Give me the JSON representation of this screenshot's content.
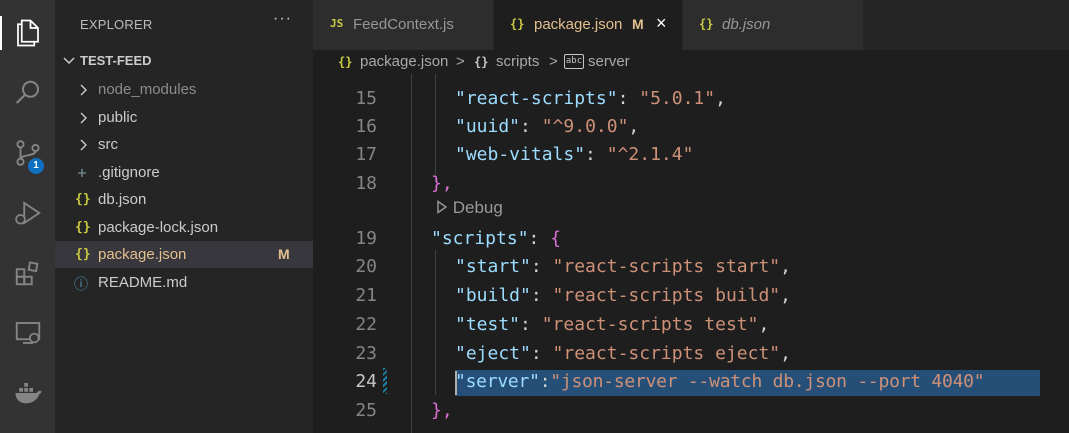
{
  "activity": {
    "items": [
      {
        "icon": "files-icon"
      },
      {
        "icon": "search-icon"
      },
      {
        "icon": "source-control-icon",
        "badge": "1"
      },
      {
        "icon": "run-debug-icon"
      },
      {
        "icon": "extensions-icon"
      },
      {
        "icon": "remote-explorer-icon"
      },
      {
        "icon": "docker-icon"
      }
    ]
  },
  "sidebar": {
    "title": "EXPLORER",
    "more": "···",
    "folder": "TEST-FEED",
    "items": [
      {
        "label": "node_modules",
        "type": "folder",
        "color": "#8c8c8c"
      },
      {
        "label": "public",
        "type": "folder",
        "color": "#cccccc"
      },
      {
        "label": "src",
        "type": "folder",
        "color": "#cccccc"
      },
      {
        "label": ".gitignore",
        "type": "file",
        "icon": "gitignore-icon"
      },
      {
        "label": "db.json",
        "type": "file",
        "icon": "json-icon",
        "glyph": "{}"
      },
      {
        "label": "package-lock.json",
        "type": "file",
        "icon": "json-icon",
        "glyph": "{}"
      },
      {
        "label": "package.json",
        "type": "file",
        "icon": "json-icon",
        "glyph": "{}",
        "status": "M",
        "selected": true
      },
      {
        "label": "README.md",
        "type": "file",
        "icon": "info-icon",
        "glyph": "ⓘ"
      }
    ]
  },
  "tabs": [
    {
      "label": "FeedContext.js",
      "icon": "js-icon",
      "glyph": "JS"
    },
    {
      "label": "package.json",
      "icon": "json-icon",
      "glyph": "{}",
      "modified": "M",
      "active": true,
      "close": "×"
    },
    {
      "label": "db.json",
      "icon": "json-icon",
      "glyph": "{}",
      "italic": true
    }
  ],
  "breadcrumb": {
    "file": "package.json",
    "section": "scripts",
    "item": "server",
    "sep": ">",
    "section_glyph": "{}",
    "item_glyph": "abc"
  },
  "editor": {
    "codelens": "Debug",
    "current_line": "24",
    "lines": [
      {
        "n": "15",
        "key": "\"react-scripts\"",
        "val": "\"5.0.1\"",
        "tail": ","
      },
      {
        "n": "16",
        "key": "\"uuid\"",
        "val": "\"^9.0.0\"",
        "tail": ","
      },
      {
        "n": "17",
        "key": "\"web-vitals\"",
        "val": "\"^2.1.4\"",
        "tail": ""
      },
      {
        "n": "18",
        "close": "},"
      },
      {
        "n": "19",
        "key": "\"scripts\"",
        "open": "{"
      },
      {
        "n": "20",
        "key": "\"start\"",
        "val": "\"react-scripts start\"",
        "tail": ","
      },
      {
        "n": "21",
        "key": "\"build\"",
        "val": "\"react-scripts build\"",
        "tail": ","
      },
      {
        "n": "22",
        "key": "\"test\"",
        "val": "\"react-scripts test\"",
        "tail": ","
      },
      {
        "n": "23",
        "key": "\"eject\"",
        "val": "\"react-scripts eject\"",
        "tail": ","
      },
      {
        "n": "24",
        "key": "\"server\"",
        "val": "\"json-server --watch db.json --port 4040\"",
        "tail": ""
      },
      {
        "n": "25",
        "close": "},"
      }
    ]
  }
}
